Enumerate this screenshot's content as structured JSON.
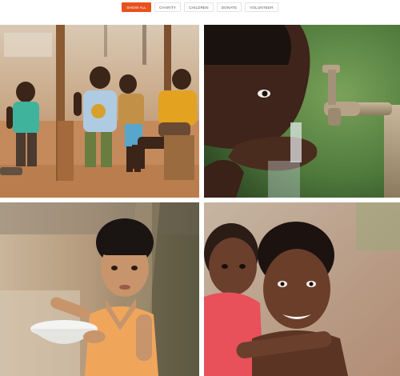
{
  "filters": [
    {
      "label": "Show All",
      "active": true
    },
    {
      "label": "Charity",
      "active": false
    },
    {
      "label": "Children",
      "active": false
    },
    {
      "label": "Donate",
      "active": false
    },
    {
      "label": "Volunteer",
      "active": false
    }
  ],
  "gallery": {
    "items": [
      {
        "subject": "children-group-photo"
      },
      {
        "subject": "drinking-from-tap-photo"
      },
      {
        "subject": "child-with-bowl-photo"
      },
      {
        "subject": "two-children-hug-photo"
      }
    ]
  },
  "colors": {
    "accent": "#e8521e",
    "button_border": "#e4e4e4",
    "button_text": "#555555"
  }
}
